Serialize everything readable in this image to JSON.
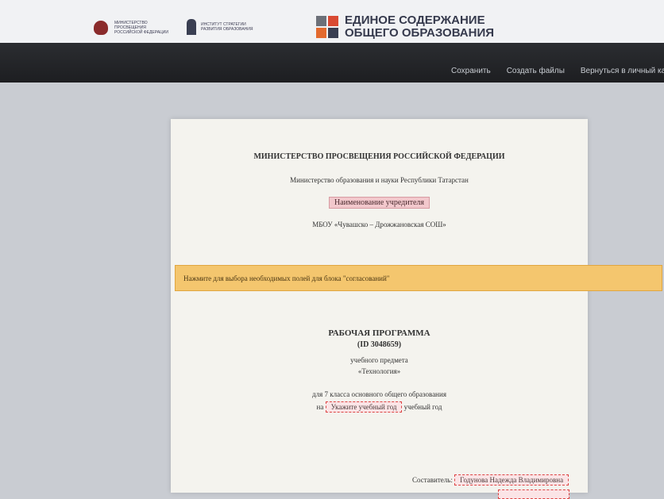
{
  "header": {
    "ministry_logo_text": "МИНИСТЕРСТВО ПРОСВЕЩЕНИЯ РОССИЙСКОЙ ФЕДЕРАЦИИ",
    "institute_logo_text": "ИНСТИТУТ СТРАТЕГИИ РАЗВИТИЯ ОБРАЗОВАНИЯ",
    "brand_line1": "ЕДИНОЕ СОДЕРЖАНИЕ",
    "brand_line2": "ОБЩЕГО ОБРАЗОВАНИЯ"
  },
  "nav": {
    "save": "Сохранить",
    "create_files": "Создать файлы",
    "back": "Вернуться в личный каби"
  },
  "document": {
    "ministry": "МИНИСТЕРСТВО ПРОСВЕЩЕНИЯ РОССИЙСКОЙ ФЕДЕРАЦИИ",
    "regional_ministry": "Министерство образования и науки Республики Татарстан",
    "founder_placeholder": "Наименование учредителя",
    "school": "МБОУ «Чувашско – Дрожжановская СОШ»",
    "notice": "Нажмите для выбора необходимых полей для блока \"согласований\"",
    "title": "РАБОЧАЯ ПРОГРАММА",
    "id": "(ID 3048659)",
    "subject_label": "учебного предмета",
    "subject": "«Технология»",
    "class_text": "для 7 класса основного общего образования",
    "year_prefix": "на",
    "year_placeholder": "Укажите учебный год",
    "year_suffix": "учебный год",
    "author_label": "Составитель:",
    "author_name": "Годунова Надежда Владимировна"
  }
}
